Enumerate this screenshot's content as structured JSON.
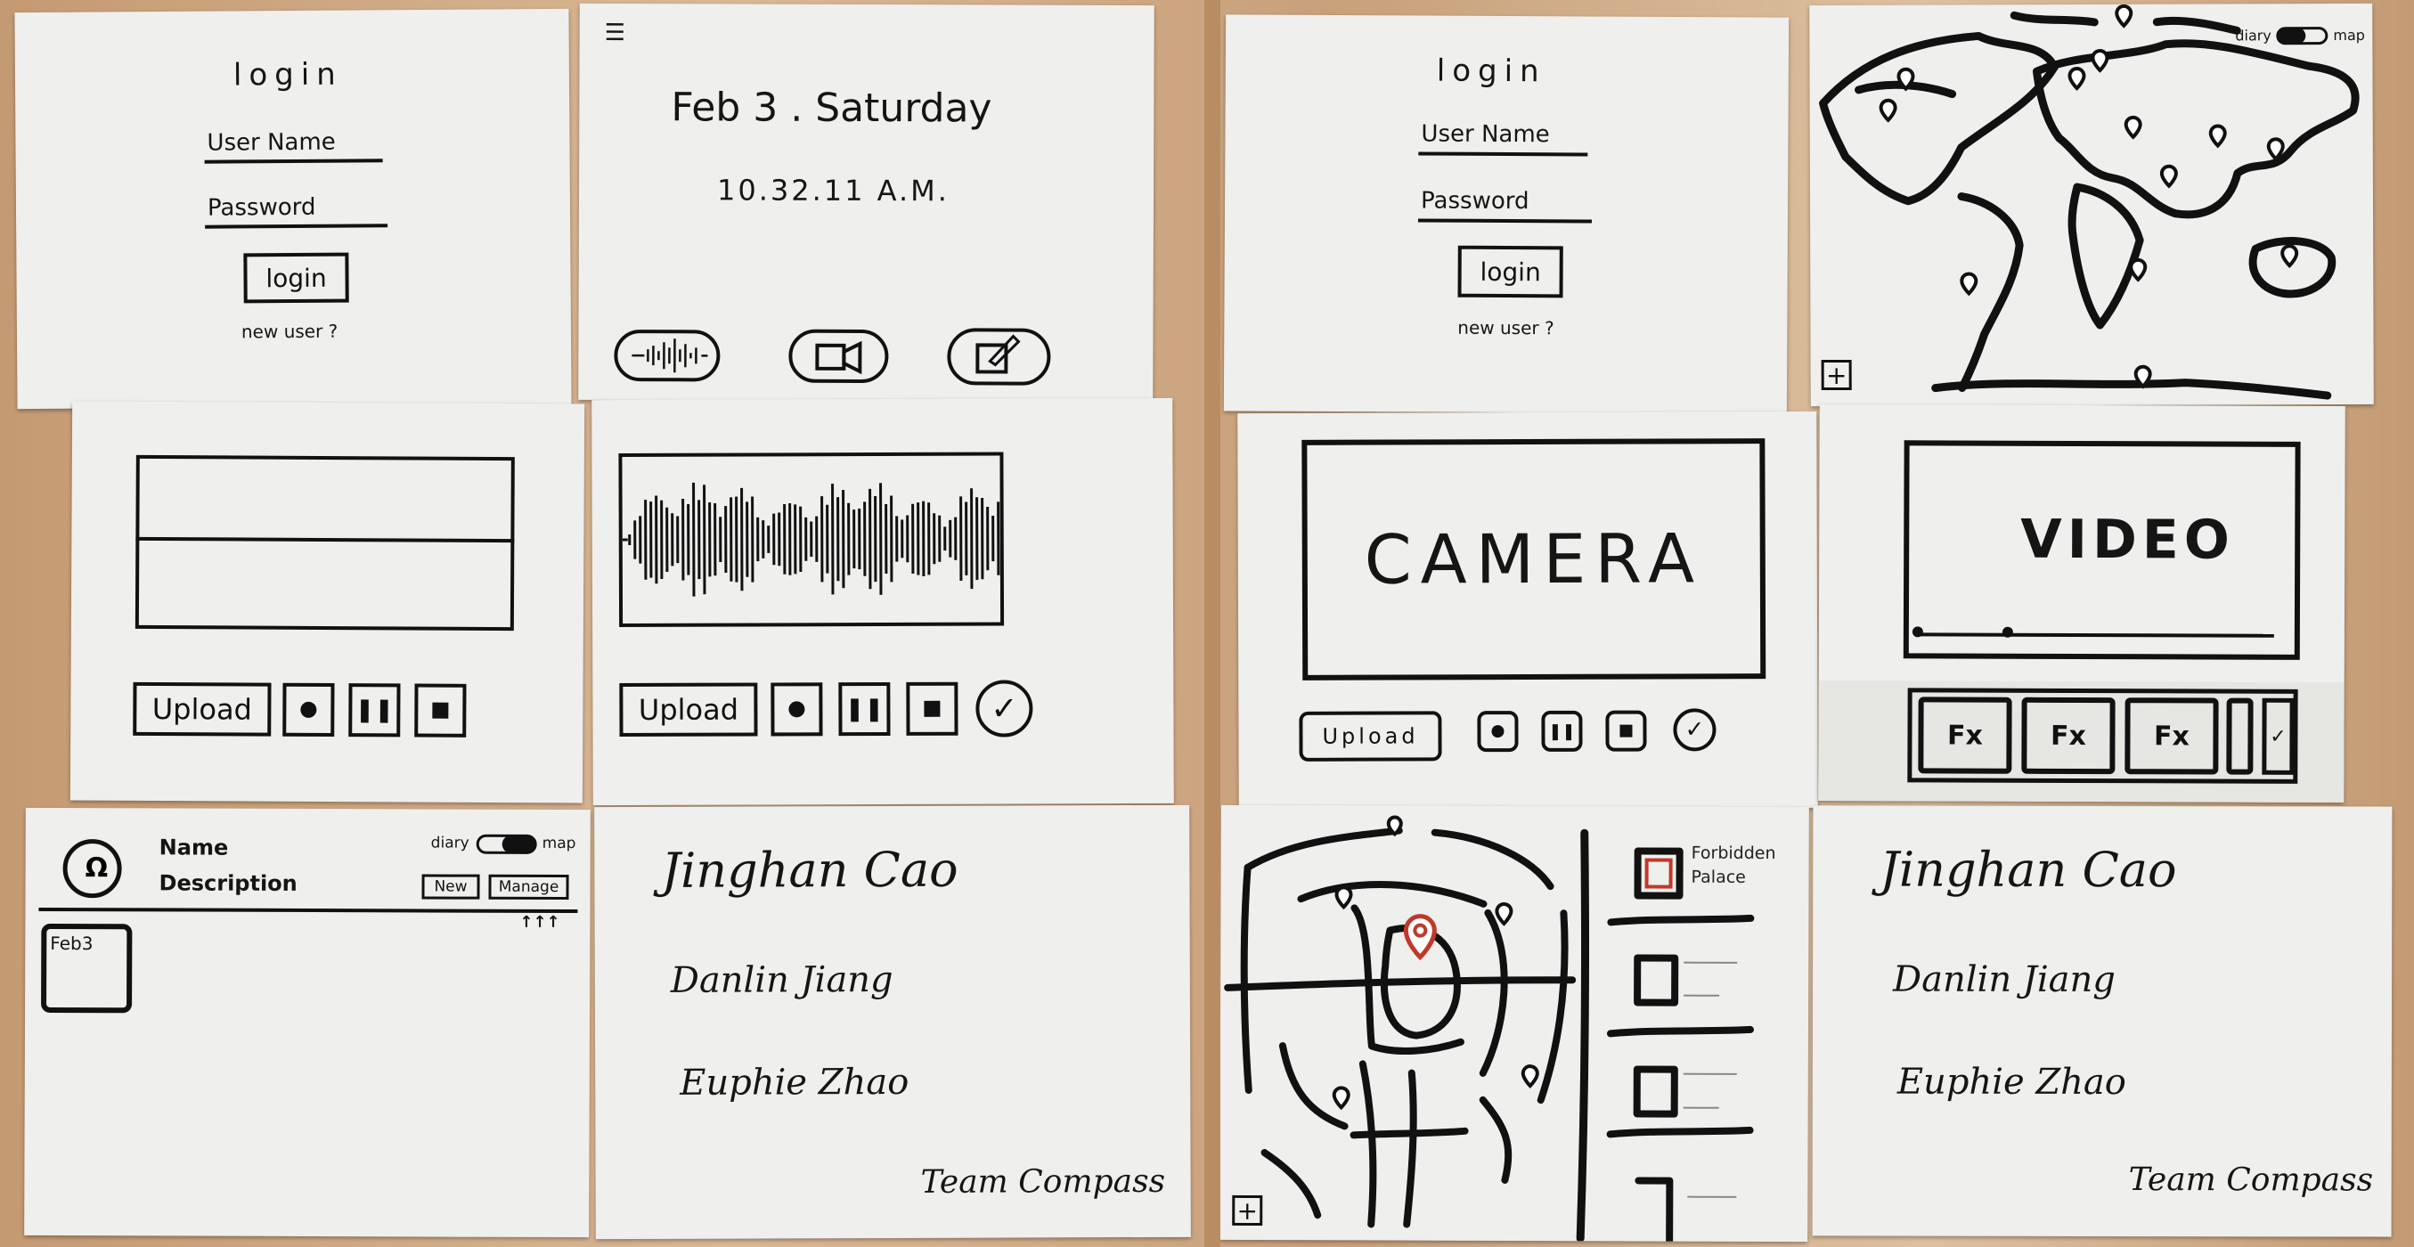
{
  "colors": {
    "ink": "#111111",
    "paper": "#efefed",
    "table": "#c9a47f",
    "pin_red": "#c0392b"
  },
  "login_screen": {
    "title": "login",
    "username_label": "User Name",
    "password_label": "Password",
    "login_button": "login",
    "new_user_link": "new user ?"
  },
  "home_screen": {
    "menu_icon": "menu-icon",
    "date": "Feb 3 . Saturday",
    "time": "10.32.11 A.M."
  },
  "toggle": {
    "left": "diary",
    "right": "map"
  },
  "recorder": {
    "upload_label": "Upload",
    "camera_label": "CAMERA",
    "video_label": "VIDEO",
    "camera_upload_label": "Upload",
    "fx_label": "Fx"
  },
  "profile_screen": {
    "name_label": "Name",
    "description_label": "Description",
    "new_button": "New",
    "manage_button": "Manage",
    "entry_label": "Feb3"
  },
  "map_screen": {
    "place_label_line1": "Forbidden",
    "place_label_line2": "Palace"
  },
  "credits": {
    "names": [
      "Jinghan Cao",
      "Danlin Jiang",
      "Euphie Zhao"
    ],
    "team": "Team Compass"
  }
}
